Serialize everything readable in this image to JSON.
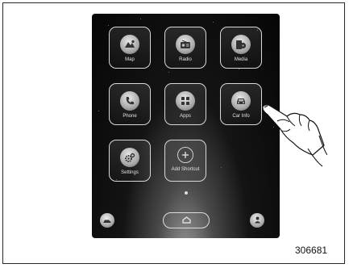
{
  "apps": [
    {
      "label": "Map",
      "icon": "map-icon"
    },
    {
      "label": "Radio",
      "icon": "radio-icon"
    },
    {
      "label": "Media",
      "icon": "media-icon"
    },
    {
      "label": "Phone",
      "icon": "phone-icon"
    },
    {
      "label": "Apps",
      "icon": "apps-grid-icon"
    },
    {
      "label": "Car Info",
      "icon": "car-icon"
    },
    {
      "label": "Settings",
      "icon": "gear-icon"
    },
    {
      "label": "Add Shortcut",
      "icon": "plus-circle-icon"
    }
  ],
  "dock": {
    "left_icon": "car-side-icon",
    "home_icon": "home-icon",
    "right_icon": "person-icon"
  },
  "figure_code": "306681"
}
